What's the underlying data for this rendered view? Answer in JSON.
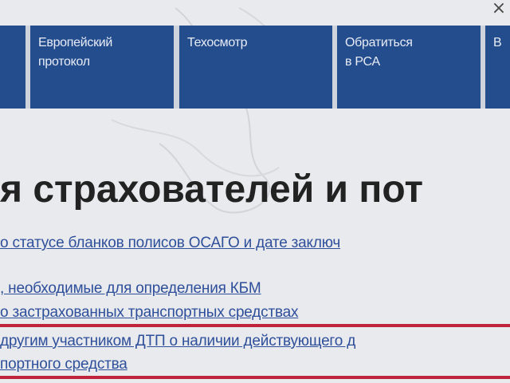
{
  "window": {
    "close_glyph": "×"
  },
  "nav": {
    "items": [
      {
        "label": ""
      },
      {
        "label": "Европейский\nпротокол"
      },
      {
        "label": "Техосмотр"
      },
      {
        "label": "Обратиться\nв РСА"
      },
      {
        "label": "В"
      }
    ]
  },
  "page": {
    "heading": "я страхователей и пот"
  },
  "links": [
    {
      "text": "о статусе бланков полисов ОСАГО и дате заключ"
    },
    {
      "text": ", необходимые для определения КБМ"
    },
    {
      "text": "о застрахованных транспортных средствах"
    },
    {
      "text": "другим участником ДТП о наличии действующего д"
    },
    {
      "text": "портного средства"
    }
  ],
  "colors": {
    "nav_bg": "#244d8e",
    "link": "#2e4f9a",
    "highlight": "#c0243a"
  }
}
